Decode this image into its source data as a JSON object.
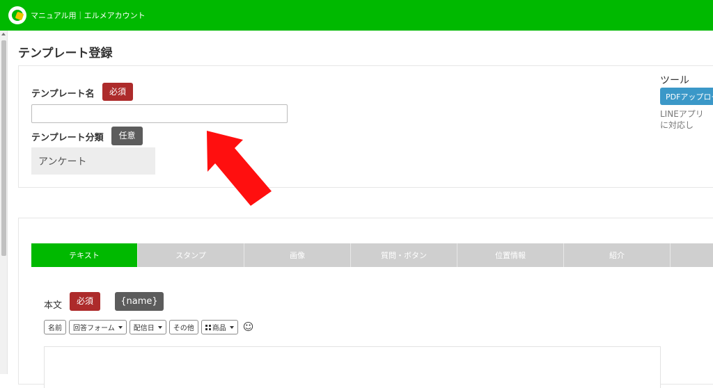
{
  "header": {
    "account_name": "マニュアル用｜エルメアカウント",
    "brand_color": "#00b900"
  },
  "page": {
    "title": "テンプレート登録"
  },
  "form": {
    "template_name_label": "テンプレート名",
    "required_badge": "必須",
    "template_name_value": "",
    "category_label": "テンプレート分類",
    "optional_badge": "任意",
    "category_value": "アンケート"
  },
  "tabs": [
    {
      "label": "テキスト",
      "active": true
    },
    {
      "label": "スタンプ",
      "active": false
    },
    {
      "label": "画像",
      "active": false
    },
    {
      "label": "質問・ボタン",
      "active": false
    },
    {
      "label": "位置情報",
      "active": false
    },
    {
      "label": "紹介",
      "active": false
    },
    {
      "label": "",
      "active": false
    }
  ],
  "message": {
    "body_label": "本文",
    "required_badge": "必須",
    "name_variable_button": "{name}",
    "toolbar": {
      "name": "名前",
      "answer_form": "回答フォーム",
      "delivery_date": "配信日",
      "other": "その他",
      "product": "商品",
      "emoji_icon": "smiley-icon"
    }
  },
  "tools": {
    "title": "ツール",
    "pdf_button": "PDFアップロード",
    "note_line1": "LINEアプリ",
    "note_line2": "に対応し"
  },
  "annotation": {
    "arrow_color": "#ff0f0f"
  }
}
